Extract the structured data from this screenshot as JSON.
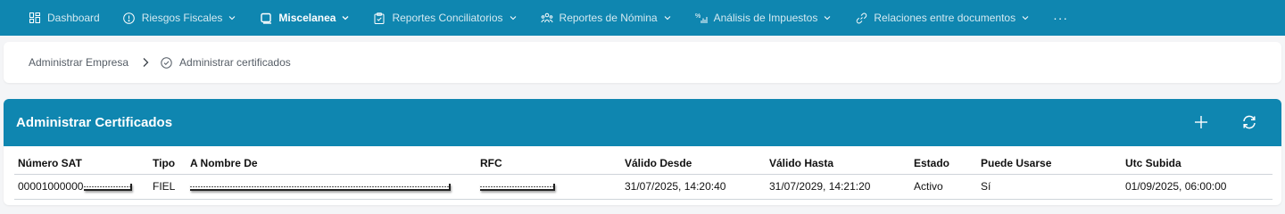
{
  "nav": {
    "items": [
      {
        "label": "Dashboard",
        "icon": "dashboard-icon",
        "chevron": false,
        "active": false
      },
      {
        "label": "Riesgos Fiscales",
        "icon": "alert-circle-icon",
        "chevron": true,
        "active": false
      },
      {
        "label": "Miscelanea",
        "icon": "window-icon",
        "chevron": true,
        "active": true
      },
      {
        "label": "Reportes Conciliatorios",
        "icon": "clipboard-icon",
        "chevron": true,
        "active": false
      },
      {
        "label": "Reportes de Nómina",
        "icon": "people-icon",
        "chevron": true,
        "active": false
      },
      {
        "label": "Análisis de Impuestos",
        "icon": "analytics-icon",
        "chevron": true,
        "active": false
      },
      {
        "label": "Relaciones entre documentos",
        "icon": "link-icon",
        "chevron": true,
        "active": false
      }
    ],
    "more_label": "···"
  },
  "breadcrumb": {
    "parent": "Administrar Empresa",
    "current": "Administrar certificados"
  },
  "panel": {
    "title": "Administrar Certificados",
    "columns": [
      "Número SAT",
      "Tipo",
      "A Nombre De",
      "RFC",
      "Válido Desde",
      "Válido Hasta",
      "Estado",
      "Puede Usarse",
      "Utc Subida"
    ],
    "rows": [
      {
        "numero_sat": "00001000000",
        "tipo": "FIEL",
        "a_nombre_de": "",
        "rfc": "",
        "valido_desde": "31/07/2025, 14:20:40",
        "valido_hasta": "31/07/2029, 14:21:20",
        "estado": "Activo",
        "puede_usarse": "Sí",
        "utc_subida": "01/09/2025, 06:00:00"
      }
    ]
  },
  "colors": {
    "brand": "#0f86b0",
    "background": "#f4f5f7"
  }
}
